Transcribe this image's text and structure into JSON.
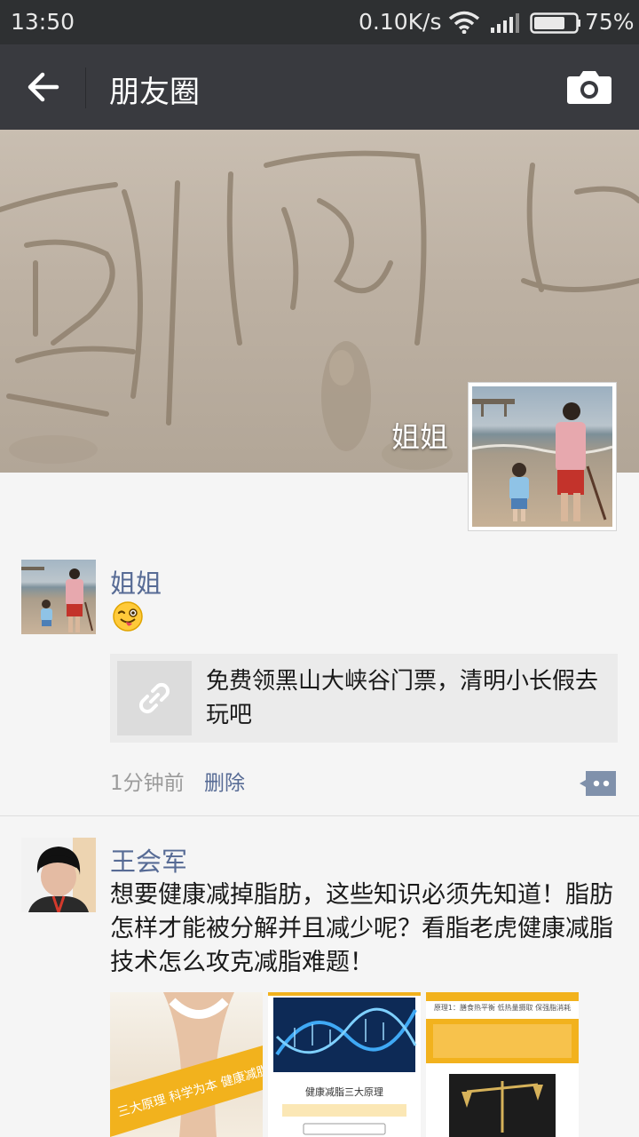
{
  "status_bar": {
    "time": "13:50",
    "network_speed": "0.10K/s",
    "battery_percent": "75%",
    "battery_level": 0.75,
    "icons": [
      "wifi-icon",
      "signal-icon",
      "battery-icon"
    ]
  },
  "nav": {
    "back_icon": "arrow-left-icon",
    "title": "朋友圈",
    "camera_icon": "camera-icon"
  },
  "profile": {
    "cover_name": "姐姐"
  },
  "posts": [
    {
      "author": "姐姐",
      "emoji": "winking-tongue-face",
      "link": {
        "icon": "link-icon",
        "text": "免费领黑山大峡谷门票，清明小长假去玩吧"
      },
      "time": "1分钟前",
      "delete_label": "删除",
      "comment_icon": "comment-icon"
    },
    {
      "author": "王会军",
      "text": "想要健康减掉脂肪，这些知识必须先知道！脂肪怎样才能被分解并且减少呢？看脂老虎健康减脂技术怎么攻克减脂难题！",
      "images": [
        {
          "caption": "三大原理 科学为本 健康减脂 有理可循"
        },
        {
          "caption": "健康减脂三大原理"
        },
        {
          "caption": "原理1：膳食热平衡 低热量摄取 保强脂消耗"
        }
      ]
    }
  ],
  "colors": {
    "status_bar_bg": "#2e3032",
    "nav_bg": "#393a3f",
    "name_link": "#576b95",
    "page_bg": "#f5f5f5"
  }
}
